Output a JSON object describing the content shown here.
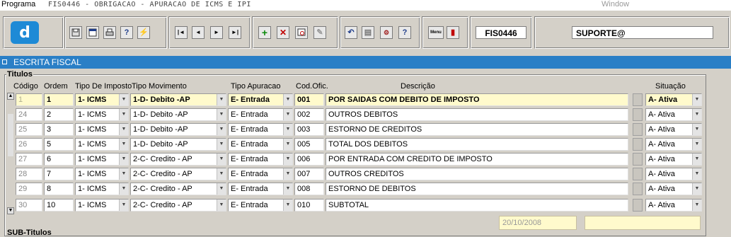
{
  "titlebar": {
    "program_label": "Programa",
    "caption": "FIS0446 - OBRIGACAO - APURACAO DE ICMS E IPI",
    "window_menu": "Window"
  },
  "toolbar": {
    "logo_letter": "d",
    "program_code": "FIS0446",
    "user": "SUPORTE@",
    "buttons": {
      "save": "save-icon",
      "screen": "window-icon",
      "print": "printer-icon",
      "help_context": "help-question-icon",
      "wand": "wand-icon",
      "first": "|◄",
      "prev": "◄",
      "next": "►",
      "last": "►|",
      "add": "+",
      "delete": "✕",
      "find": "find-icon",
      "clear": "eraser-icon",
      "undo": "↶",
      "copy": "copy-icon",
      "tools": "tools-icon",
      "help": "?",
      "menu": "Menu",
      "exit": "exit-icon"
    }
  },
  "panel": {
    "title": "ESCRITA FISCAL"
  },
  "section": {
    "title": "Titulos",
    "sub_title": "SUB-Titulos"
  },
  "columns": {
    "codigo": "Código",
    "ordem": "Ordem",
    "tipo_imposto": "Tipo De Imposto",
    "tipo_movimento": "Tipo Movimento",
    "tipo_apuracao": "Tipo Apuracao",
    "cod_ofic": "Cod.Ofic.",
    "descricao": "Descrição",
    "situacao": "Situação"
  },
  "rows": [
    {
      "codigo": "1",
      "ordem": "1",
      "imposto": "1- ICMS",
      "movimento": "1-D- Debito -AP",
      "apuracao": "E- Entrada",
      "cod": "001",
      "descricao": "POR SAIDAS COM DEBITO DE IMPOSTO",
      "situacao": "A- Ativa"
    },
    {
      "codigo": "24",
      "ordem": "2",
      "imposto": "1- ICMS",
      "movimento": "1-D- Debito -AP",
      "apuracao": "E- Entrada",
      "cod": "002",
      "descricao": "OUTROS DEBITOS",
      "situacao": "A- Ativa"
    },
    {
      "codigo": "25",
      "ordem": "3",
      "imposto": "1- ICMS",
      "movimento": "1-D- Debito -AP",
      "apuracao": "E- Entrada",
      "cod": "003",
      "descricao": "ESTORNO DE CREDITOS",
      "situacao": "A- Ativa"
    },
    {
      "codigo": "26",
      "ordem": "5",
      "imposto": "1- ICMS",
      "movimento": "1-D- Debito -AP",
      "apuracao": "E- Entrada",
      "cod": "005",
      "descricao": "TOTAL DOS DEBITOS",
      "situacao": "A- Ativa"
    },
    {
      "codigo": "27",
      "ordem": "6",
      "imposto": "1- ICMS",
      "movimento": "2-C- Credito - AP",
      "apuracao": "E- Entrada",
      "cod": "006",
      "descricao": "POR ENTRADA COM CREDITO DE IMPOSTO",
      "situacao": "A- Ativa"
    },
    {
      "codigo": "28",
      "ordem": "7",
      "imposto": "1- ICMS",
      "movimento": "2-C- Credito - AP",
      "apuracao": "E- Entrada",
      "cod": "007",
      "descricao": "OUTROS CREDITOS",
      "situacao": "A- Ativa"
    },
    {
      "codigo": "29",
      "ordem": "8",
      "imposto": "1- ICMS",
      "movimento": "2-C- Credito - AP",
      "apuracao": "E- Entrada",
      "cod": "008",
      "descricao": "ESTORNO DE DEBITOS",
      "situacao": "A- Ativa"
    },
    {
      "codigo": "30",
      "ordem": "10",
      "imposto": "1- ICMS",
      "movimento": "2-C- Credito - AP",
      "apuracao": "E- Entrada",
      "cod": "010",
      "descricao": "SUBTOTAL",
      "situacao": "A- Ativa"
    }
  ],
  "footer": {
    "date": "20/10/2008",
    "extra": ""
  },
  "colors": {
    "panel": "#2a7fc6",
    "current_row": "#fffacc",
    "background": "#d4d0c8"
  }
}
